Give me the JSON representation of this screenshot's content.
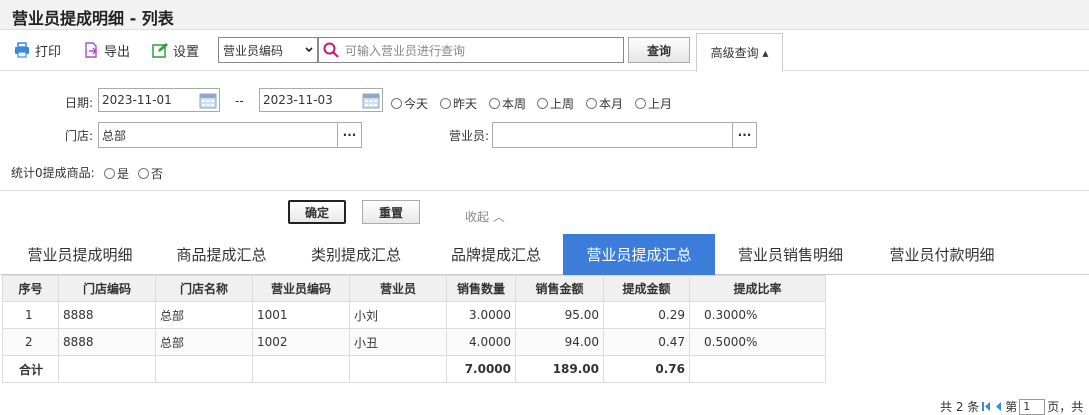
{
  "title": "营业员提成明细 - 列表",
  "toolbar": {
    "print": "打印",
    "export": "导出",
    "settings": "设置",
    "search_field": "营业员编码",
    "search_placeholder": "可输入营业员进行查询",
    "query": "查询",
    "advanced": "高级查询 ▴"
  },
  "filters": {
    "date_label": "日期:",
    "date_from": "2023-11-01",
    "date_sep": "--",
    "date_to": "2023-11-03",
    "quick": [
      "今天",
      "昨天",
      "本周",
      "上周",
      "本月",
      "上月"
    ],
    "store_label": "门店:",
    "store_value": "总部",
    "clerk_label": "营业员:",
    "clerk_value": "",
    "zero_label": "统计0提成商品:",
    "zero_yes": "是",
    "zero_no": "否",
    "ok": "确定",
    "reset": "重置",
    "collapse": "收起 ︿"
  },
  "tabs": [
    "营业员提成明细",
    "商品提成汇总",
    "类别提成汇总",
    "品牌提成汇总",
    "营业员提成汇总",
    "营业员销售明细",
    "营业员付款明细"
  ],
  "active_tab": 4,
  "table": {
    "headers": [
      "序号",
      "门店编码",
      "门店名称",
      "营业员编码",
      "营业员",
      "销售数量",
      "销售金额",
      "提成金额",
      "提成比率"
    ],
    "rows": [
      [
        "1",
        "8888",
        "总部",
        "1001",
        "小刘",
        "3.0000",
        "95.00",
        "0.29",
        "0.3000%"
      ],
      [
        "2",
        "8888",
        "总部",
        "1002",
        "小丑",
        "4.0000",
        "94.00",
        "0.47",
        "0.5000%"
      ]
    ],
    "total": [
      "合计",
      "",
      "",
      "",
      "",
      "7.0000",
      "189.00",
      "0.76",
      ""
    ]
  },
  "pager": {
    "total": "共 2 条",
    "page_prefix": "第",
    "page": "1",
    "page_suffix": "页，共"
  },
  "colors": {
    "accent": "#3b7dd8"
  }
}
